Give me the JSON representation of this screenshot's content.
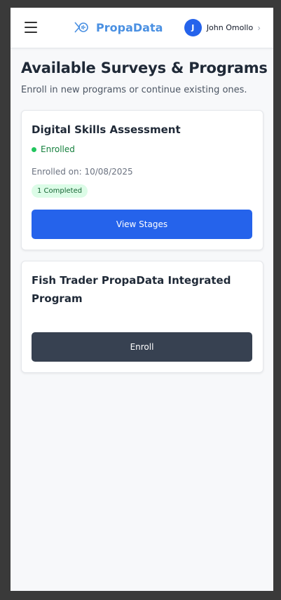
{
  "header": {
    "brand": "PropaData",
    "user_initial": "J",
    "user_name": "John Omollo",
    "chevron": "›",
    "icons": {
      "menu": "hamburger-icon",
      "logo": "propadata-logo-icon",
      "chevron": "chevron-right-icon"
    }
  },
  "page": {
    "title": "Available Surveys & Programs",
    "subtitle": "Enroll in new programs or continue existing ones."
  },
  "programs": [
    {
      "title": "Digital Skills Assessment",
      "status": "Enrolled",
      "enrolled_on": "Enrolled on: 10/08/2025",
      "badge": "1 Completed",
      "action": "View Stages"
    },
    {
      "title": "Fish Trader PropaData Integrated Program",
      "action": "Enroll"
    }
  ],
  "colors": {
    "brand": "#4a90e2",
    "primary": "#2563eb",
    "dark_button": "#374151",
    "success": "#22c55e"
  }
}
